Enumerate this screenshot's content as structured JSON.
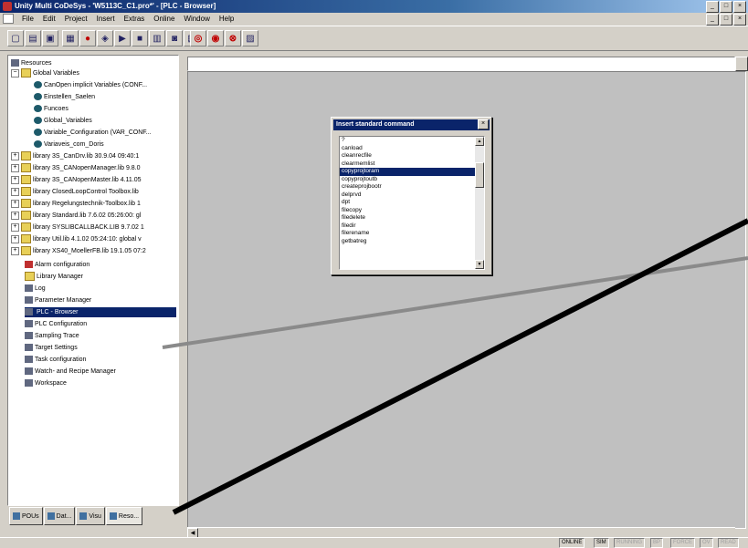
{
  "window": {
    "title": "Unity Multi CoDeSys - 'W5113C_C1.pro*' - [PLC - Browser]"
  },
  "menu": [
    "File",
    "Edit",
    "Project",
    "Insert",
    "Extras",
    "Online",
    "Window",
    "Help"
  ],
  "toolbar": {
    "icons": [
      "new-icon",
      "open-icon",
      "save-icon",
      "build-icon",
      "login-icon",
      "logout-icon",
      "run-icon",
      "stop-icon",
      "step-icon",
      "breakpoint-icon",
      "reset-icon",
      "cut-icon",
      "copy-icon",
      "paste-icon",
      "find-icon"
    ]
  },
  "tree": {
    "root": "Resources",
    "global_folder": "Global Variables",
    "global_items": [
      "CanOpen implicit Variables (CONF...",
      "Einstellen_Saelen",
      "Funcoes",
      "Global_Variables",
      "Variable_Configuration (VAR_CONF...",
      "Variaveis_com_Doris"
    ],
    "libraries": [
      "library 3S_CanDrv.lib 30.9.04 09:40:1",
      "library 3S_CANopenManager.lib 9.8.0",
      "library 3S_CANopenMaster.lib 4.11.05",
      "library ClosedLoopControl Toolbox.lib",
      "library Regelungstechnik-Toolbox.lib 1",
      "library Standard.lib 7.6.02 05:26:00: gl",
      "library SYSLIBCALLBACK.LIB 9.7.02 1",
      "library Util.lib 4.1.02 05:24:10: global v",
      "library XS40_MoellerFB.lib 19.1.05 07:2"
    ],
    "items": [
      "Alarm configuration",
      "Library Manager",
      "Log",
      "Parameter Manager",
      "PLC - Browser",
      "PLC Configuration",
      "Sampling Trace",
      "Target Settings",
      "Task configuration",
      "Watch- and Recipe Manager",
      "Workspace"
    ],
    "selected": "PLC - Browser"
  },
  "tabs": [
    "POUs",
    "Dat...",
    "Visu",
    "Reso..."
  ],
  "dialog": {
    "title": "Insert standard command",
    "items": [
      "?",
      "canload",
      "cleanrecfile",
      "clearmemlist",
      "copyprojtoram",
      "copyprojtoutb",
      "createprojbootr",
      "delprvd",
      "dpt",
      "filecopy",
      "filedelete",
      "filedir",
      "filerename",
      "getbatreg"
    ],
    "selected": "copyprojtoram"
  },
  "status": {
    "items": [
      "ONLINE",
      "SIM",
      "RUNNING",
      "BP",
      "FORCE",
      "OV",
      "READ"
    ]
  },
  "colors": {
    "title_active": "#0a246a",
    "face": "#d4d0c8",
    "workspace": "#c0c0c0",
    "selection": "#0a246a"
  }
}
